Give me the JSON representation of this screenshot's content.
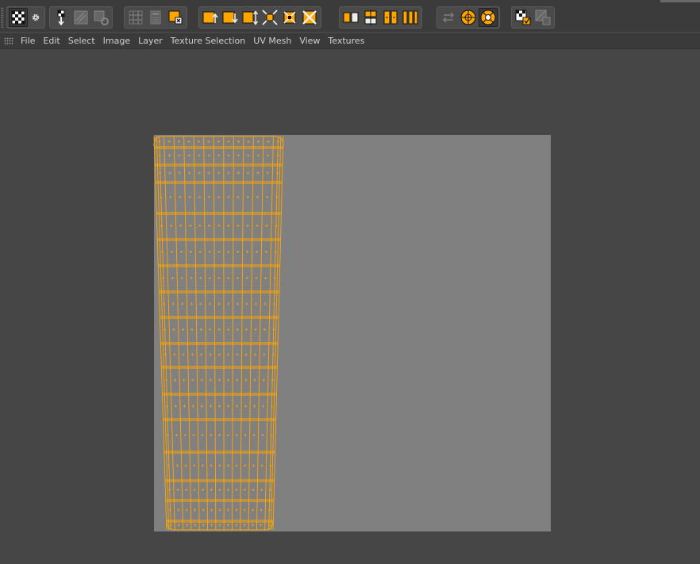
{
  "toolbar": {
    "groups": [
      [
        {
          "icon": "checker-icon",
          "state": "active"
        },
        {
          "icon": "gear-icon",
          "state": "normal"
        }
      ],
      [
        {
          "icon": "paint-brush-icon",
          "state": "normal"
        },
        {
          "icon": "texture-pattern-icon",
          "state": "disabled"
        },
        {
          "icon": "texture-tool-icon",
          "state": "disabled"
        }
      ],
      [
        {
          "icon": "checker-grid-icon",
          "state": "disabled"
        },
        {
          "icon": "calculator-icon",
          "state": "disabled"
        },
        {
          "icon": "clear-uv-icon",
          "state": "normal"
        }
      ],
      [
        {
          "icon": "move-up-icon",
          "state": "normal"
        },
        {
          "icon": "move-down-icon",
          "state": "normal"
        },
        {
          "icon": "scale-vertical-icon",
          "state": "normal"
        },
        {
          "icon": "shrink-icon",
          "state": "normal"
        },
        {
          "icon": "expand-icon",
          "state": "normal"
        },
        {
          "icon": "mirror-icon",
          "state": "normal"
        }
      ],
      [
        {
          "icon": "align-left-icon",
          "state": "normal"
        },
        {
          "icon": "align-center-icon",
          "state": "normal"
        },
        {
          "icon": "distribute-icon",
          "state": "normal"
        },
        {
          "icon": "stack-icon",
          "state": "normal"
        }
      ],
      [
        {
          "icon": "swap-icon",
          "state": "disabled"
        },
        {
          "icon": "relax-uv-icon",
          "state": "normal"
        },
        {
          "icon": "optimal-mapping-icon",
          "state": "active"
        }
      ],
      [
        {
          "icon": "uv-checker-icon",
          "state": "normal"
        },
        {
          "icon": "uv-shading-icon",
          "state": "disabled"
        }
      ]
    ]
  },
  "menu": {
    "items": [
      "File",
      "Edit",
      "Select",
      "Image",
      "Layer",
      "Texture Selection",
      "UV Mesh",
      "View",
      "Textures"
    ]
  },
  "colors": {
    "background": "#464646",
    "toolbar": "#3b3b3b",
    "menubar": "#3a3a3a",
    "canvas": "#808080",
    "mesh": "#ffa500",
    "menu_text": "#d0d0d0"
  },
  "uv_mesh": {
    "rows": 14,
    "columns": 13
  }
}
